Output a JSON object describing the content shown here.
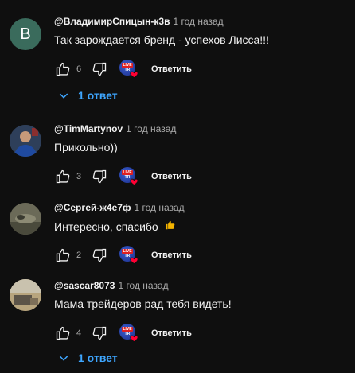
{
  "comments": [
    {
      "author": "@ВладимирСпицын-к3в",
      "time": "1 год назад",
      "text": "Так зарождается бренд - успехов Лисса!!!",
      "likes": "6",
      "avatar_letter": "В",
      "replies": "1 ответ"
    },
    {
      "author": "@TimMartynov",
      "time": "1 год назад",
      "text": "Прикольно))",
      "likes": "3"
    },
    {
      "author": "@Сергей-ж4е7ф",
      "time": "1 год назад",
      "text": "Интересно, спасибо",
      "likes": "2"
    },
    {
      "author": "@sascar8073",
      "time": "1 год назад",
      "text": "Мама трейдеров рад тебя видеть!",
      "likes": "4",
      "replies": "1 ответ"
    }
  ],
  "labels": {
    "reply": "Ответить",
    "badge_top": "LIVE",
    "badge_bottom": "TR"
  },
  "colors": {
    "background": "#0f0f0f",
    "link_blue": "#3ea6ff",
    "heart_red": "#ff0033",
    "badge_blue": "#2a47b8"
  }
}
